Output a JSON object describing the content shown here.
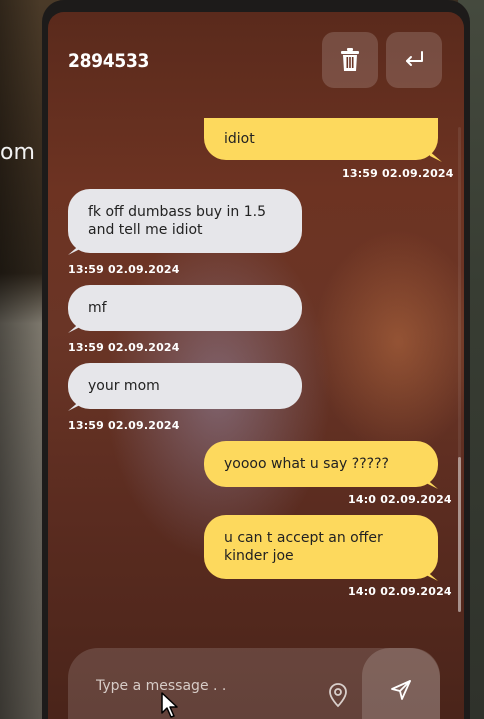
{
  "background": {
    "partial_text": "om h"
  },
  "header": {
    "title": "2894533",
    "trash_icon": "trash-icon",
    "back_icon": "return-arrow-icon"
  },
  "messages": [
    {
      "direction": "outgoing",
      "text": "idiot",
      "time": "13:59 02.09.2024"
    },
    {
      "direction": "incoming",
      "text": "fk off dumbass buy in 1.5 and tell me idiot",
      "time": "13:59 02.09.2024"
    },
    {
      "direction": "incoming",
      "text": "mf",
      "time": "13:59 02.09.2024"
    },
    {
      "direction": "incoming",
      "text": "your mom",
      "time": "13:59 02.09.2024"
    },
    {
      "direction": "outgoing",
      "text": "yoooo what u say ?????",
      "time": "14:0 02.09.2024"
    },
    {
      "direction": "outgoing",
      "text": "u can t accept an offer kinder joe",
      "time": "14:0 02.09.2024"
    }
  ],
  "composer": {
    "placeholder": "Type a message . .",
    "location_icon": "location-pin-icon",
    "send_icon": "send-icon"
  },
  "colors": {
    "incoming_bubble": "#e6e6ea",
    "outgoing_bubble": "#fdd95d"
  }
}
